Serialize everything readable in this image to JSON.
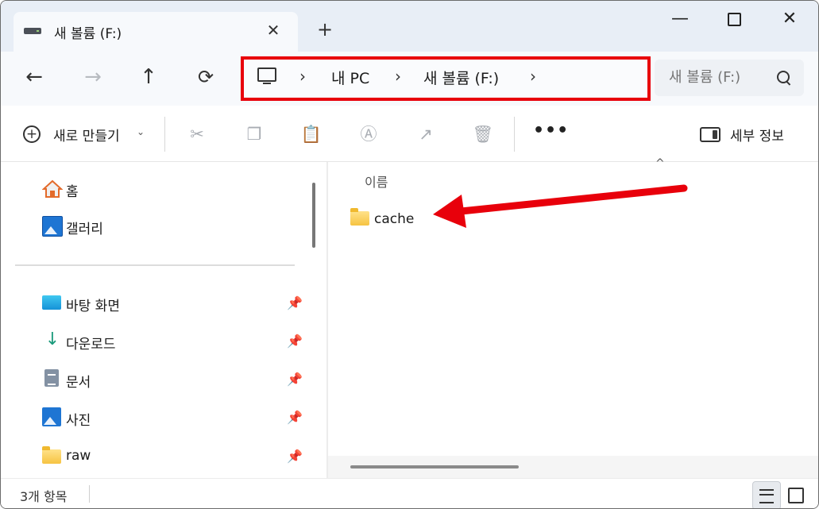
{
  "tab": {
    "title": "새 볼륨 (F:)",
    "close_glyph": "✕"
  },
  "new_tab_glyph": "+",
  "window_controls": {
    "minimize": "—",
    "close": "✕"
  },
  "nav": {
    "back": "←",
    "forward": "→",
    "up": "↑",
    "refresh": "⟳"
  },
  "address": {
    "crumbs": [
      "내 PC",
      "새 볼륨 (F:)"
    ],
    "separator": "›"
  },
  "search": {
    "placeholder": "새 볼륨 (F:)"
  },
  "toolbar": {
    "new_label": "새로 만들기",
    "new_caret": "⌄",
    "cut": "✂",
    "copy": "❐",
    "paste": "📋",
    "rename": "Ⓐ",
    "share": "↗",
    "delete": "🗑",
    "more": "•••",
    "details_label": "세부 정보"
  },
  "sidebar": {
    "items": [
      {
        "label": "홈",
        "icon": "home-icon",
        "pinned": false
      },
      {
        "label": "갤러리",
        "icon": "gallery-icon",
        "pinned": false
      },
      {
        "label": "바탕 화면",
        "icon": "desktop-icon",
        "pinned": true
      },
      {
        "label": "다운로드",
        "icon": "download-icon",
        "pinned": true
      },
      {
        "label": "문서",
        "icon": "documents-icon",
        "pinned": true
      },
      {
        "label": "사진",
        "icon": "pictures-icon",
        "pinned": true
      },
      {
        "label": "raw",
        "icon": "folder-icon",
        "pinned": true
      }
    ],
    "pin_glyph": "📌"
  },
  "content": {
    "column_header": "이름",
    "sort_caret": "^",
    "files": [
      {
        "name": "cache",
        "type": "folder"
      }
    ]
  },
  "annotation": {
    "highlight_color": "#e8000b",
    "arrow_color": "#e8000b"
  },
  "status": {
    "item_count": "3개 항목"
  }
}
